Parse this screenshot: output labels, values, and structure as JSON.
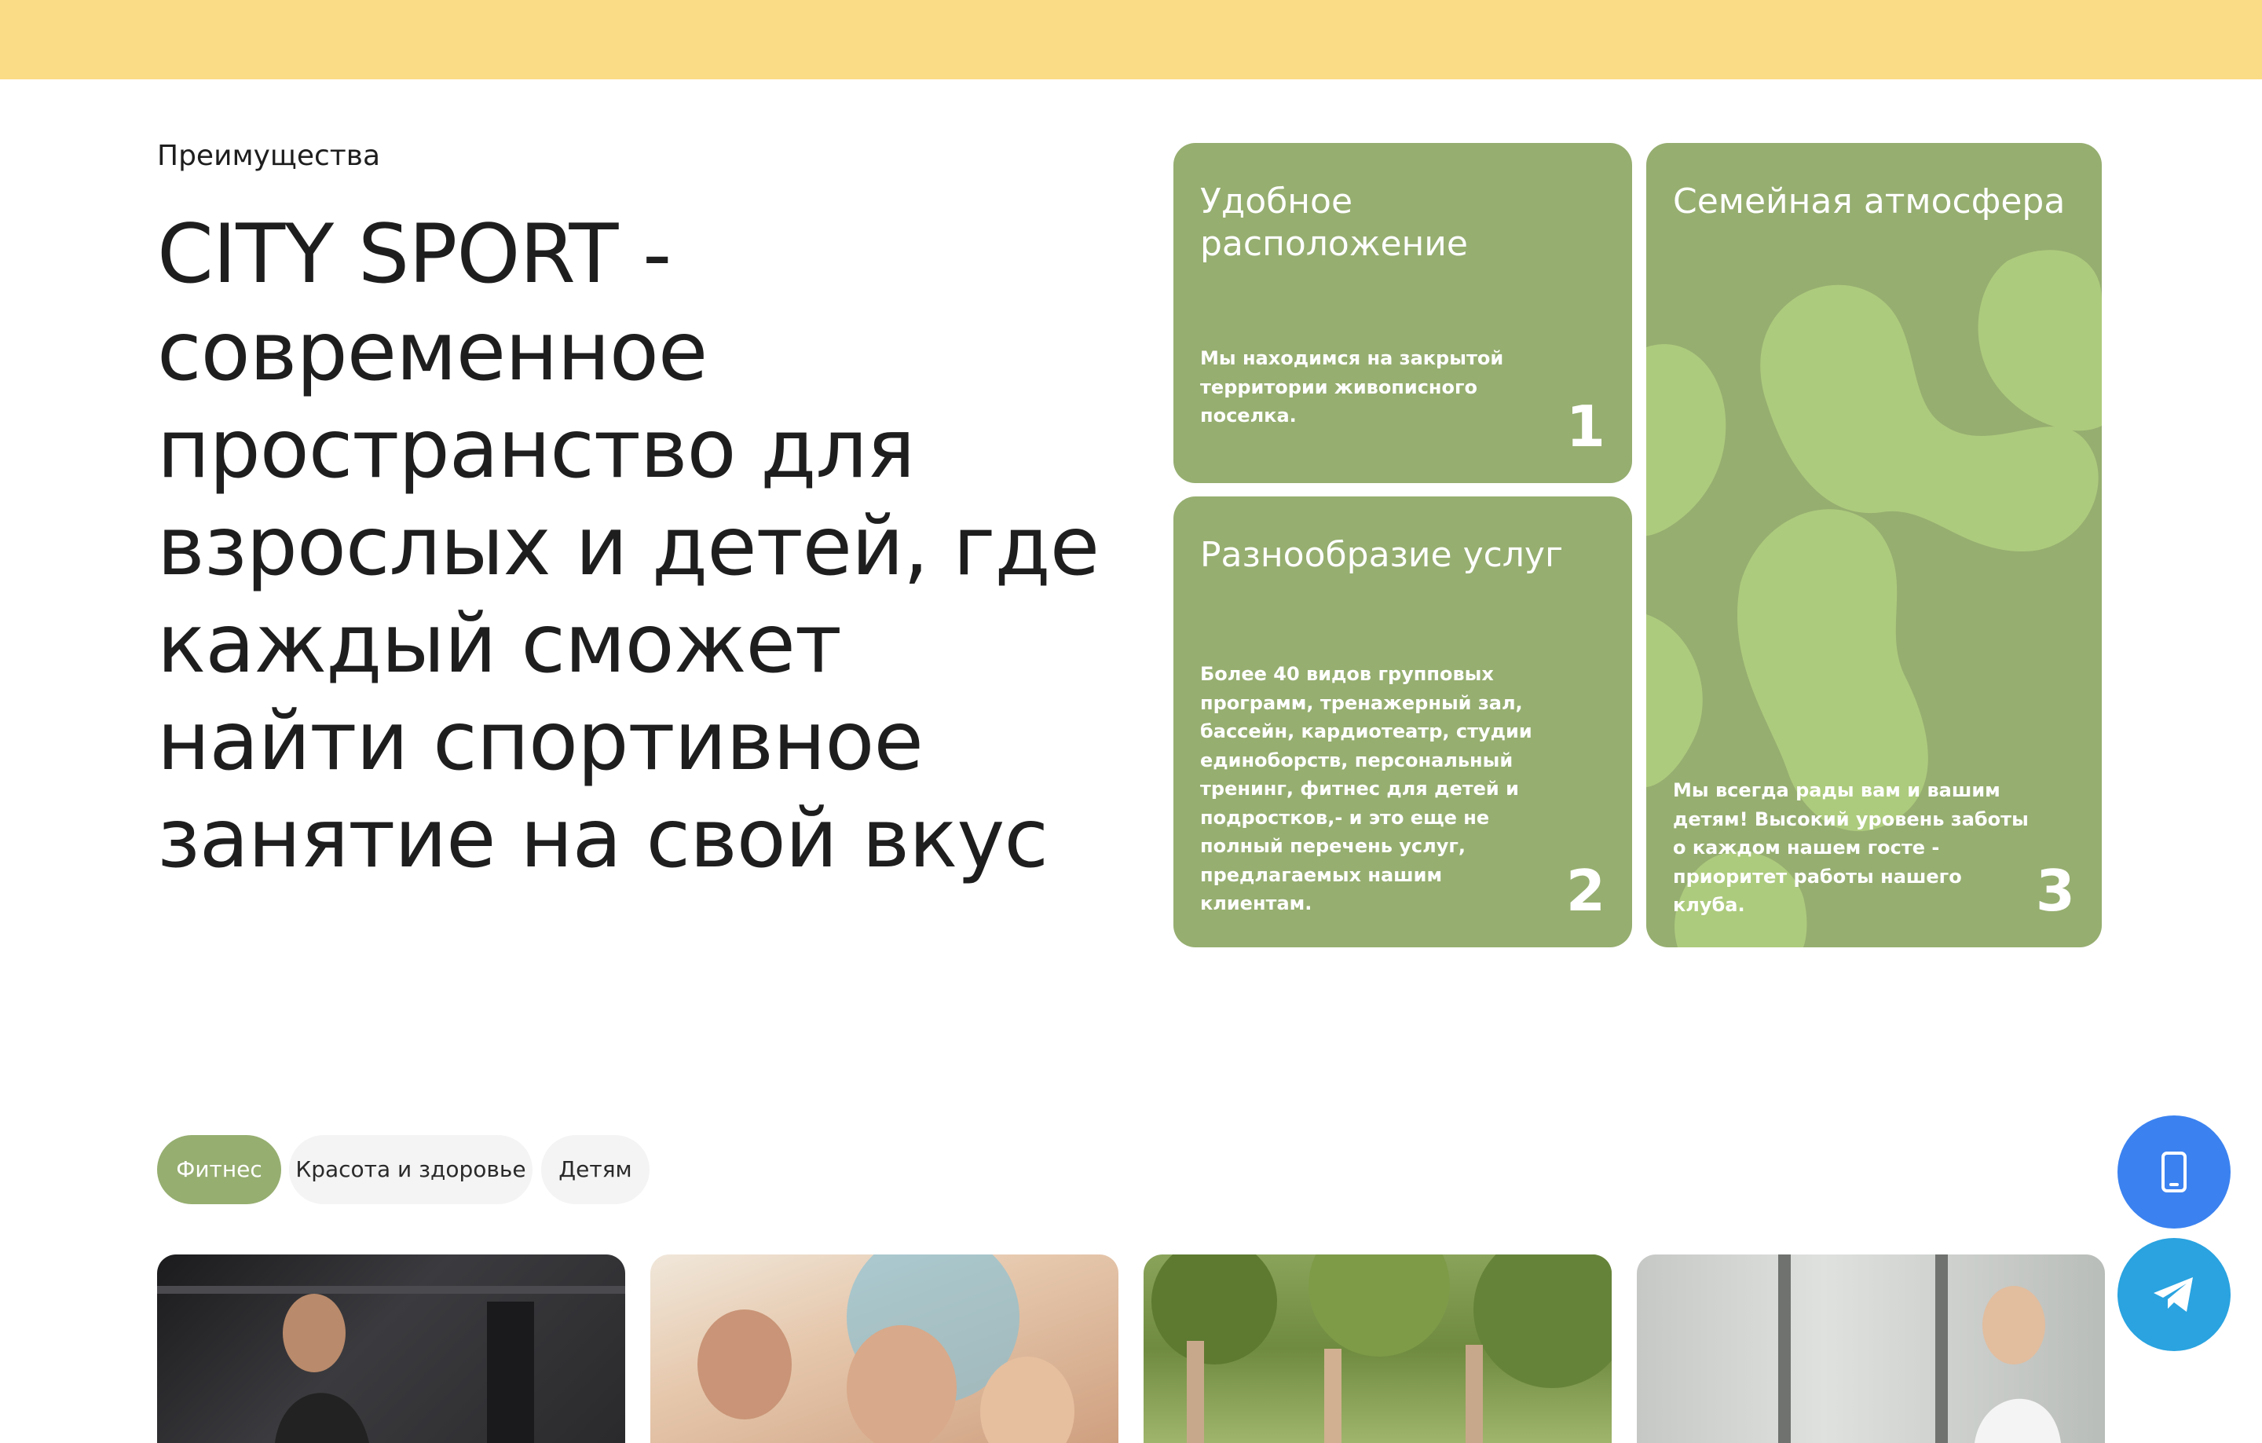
{
  "section": {
    "label": "Преимущества"
  },
  "headline": "CITY SPORT - современное пространство для взрослых и детей, где каждый сможет найти спортивное занятие на свой вкус",
  "colors": {
    "topbar": "#fadb86",
    "card": "#96ae70",
    "card_pattern": "#adcb7d",
    "tab_active": "#96ae70",
    "phone_button": "#3b82f0",
    "telegram_button": "#2aa3e0"
  },
  "cards": [
    {
      "title": "Удобное расположение",
      "text": "Мы находимся на закрытой территории живописного поселка.",
      "number": "1"
    },
    {
      "title": "Разнообразие услуг",
      "text": "Более 40 видов групповых программ, тренажерный зал, бассейн, кардиотеатр, студии единоборств, персональный тренинг, фитнес для детей и подростков,- и это еще не полный перечень услуг, предлагаемых нашим клиентам.",
      "number": "2"
    },
    {
      "title": "Семейная атмосфера",
      "text": "Мы всегда рады вам и вашим детям! Высокий уровень заботы о каждом нашем госте - приоритет работы нашего клуба.",
      "number": "3"
    }
  ],
  "tabs": [
    {
      "label": "Фитнес",
      "active": true
    },
    {
      "label": "Красота и здоровье",
      "active": false
    },
    {
      "label": "Детям",
      "active": false
    }
  ],
  "icons": {
    "phone": "phone-icon",
    "telegram": "telegram-icon"
  }
}
